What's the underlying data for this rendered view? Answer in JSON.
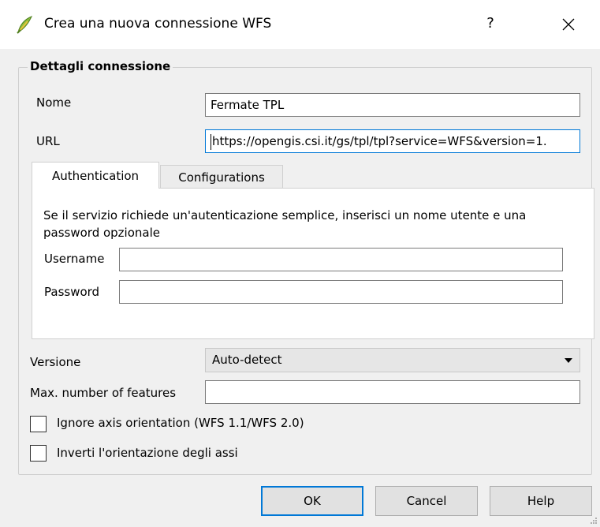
{
  "window": {
    "title": "Crea una nuova connessione WFS",
    "help_label": "?",
    "icon": "qgis-icon"
  },
  "group": {
    "title": "Dettagli connessione"
  },
  "name_field": {
    "label": "Nome",
    "value": "Fermate TPL"
  },
  "url_field": {
    "label": "URL",
    "value": "https://opengis.csi.it/gs/tpl/tpl?service=WFS&version=1."
  },
  "tabs": [
    {
      "label": "Authentication",
      "active": true
    },
    {
      "label": "Configurations",
      "active": false
    }
  ],
  "auth": {
    "info": "Se il servizio richiede un'autenticazione semplice, inserisci un nome utente e una password opzionale",
    "username_label": "Username",
    "username_value": "",
    "password_label": "Password",
    "password_value": ""
  },
  "version": {
    "label": "Versione",
    "selected": "Auto-detect"
  },
  "max_features": {
    "label": "Max. number of features",
    "value": ""
  },
  "checkboxes": [
    {
      "label": "Ignore axis orientation (WFS 1.1/WFS 2.0)",
      "checked": false
    },
    {
      "label": "Inverti l'orientazione degli assi",
      "checked": false
    }
  ],
  "buttons": {
    "ok": "OK",
    "cancel": "Cancel",
    "help": "Help"
  },
  "colors": {
    "accent": "#0078d7",
    "background": "#f0f0f0",
    "qgis_green": "#8cbf3f"
  }
}
